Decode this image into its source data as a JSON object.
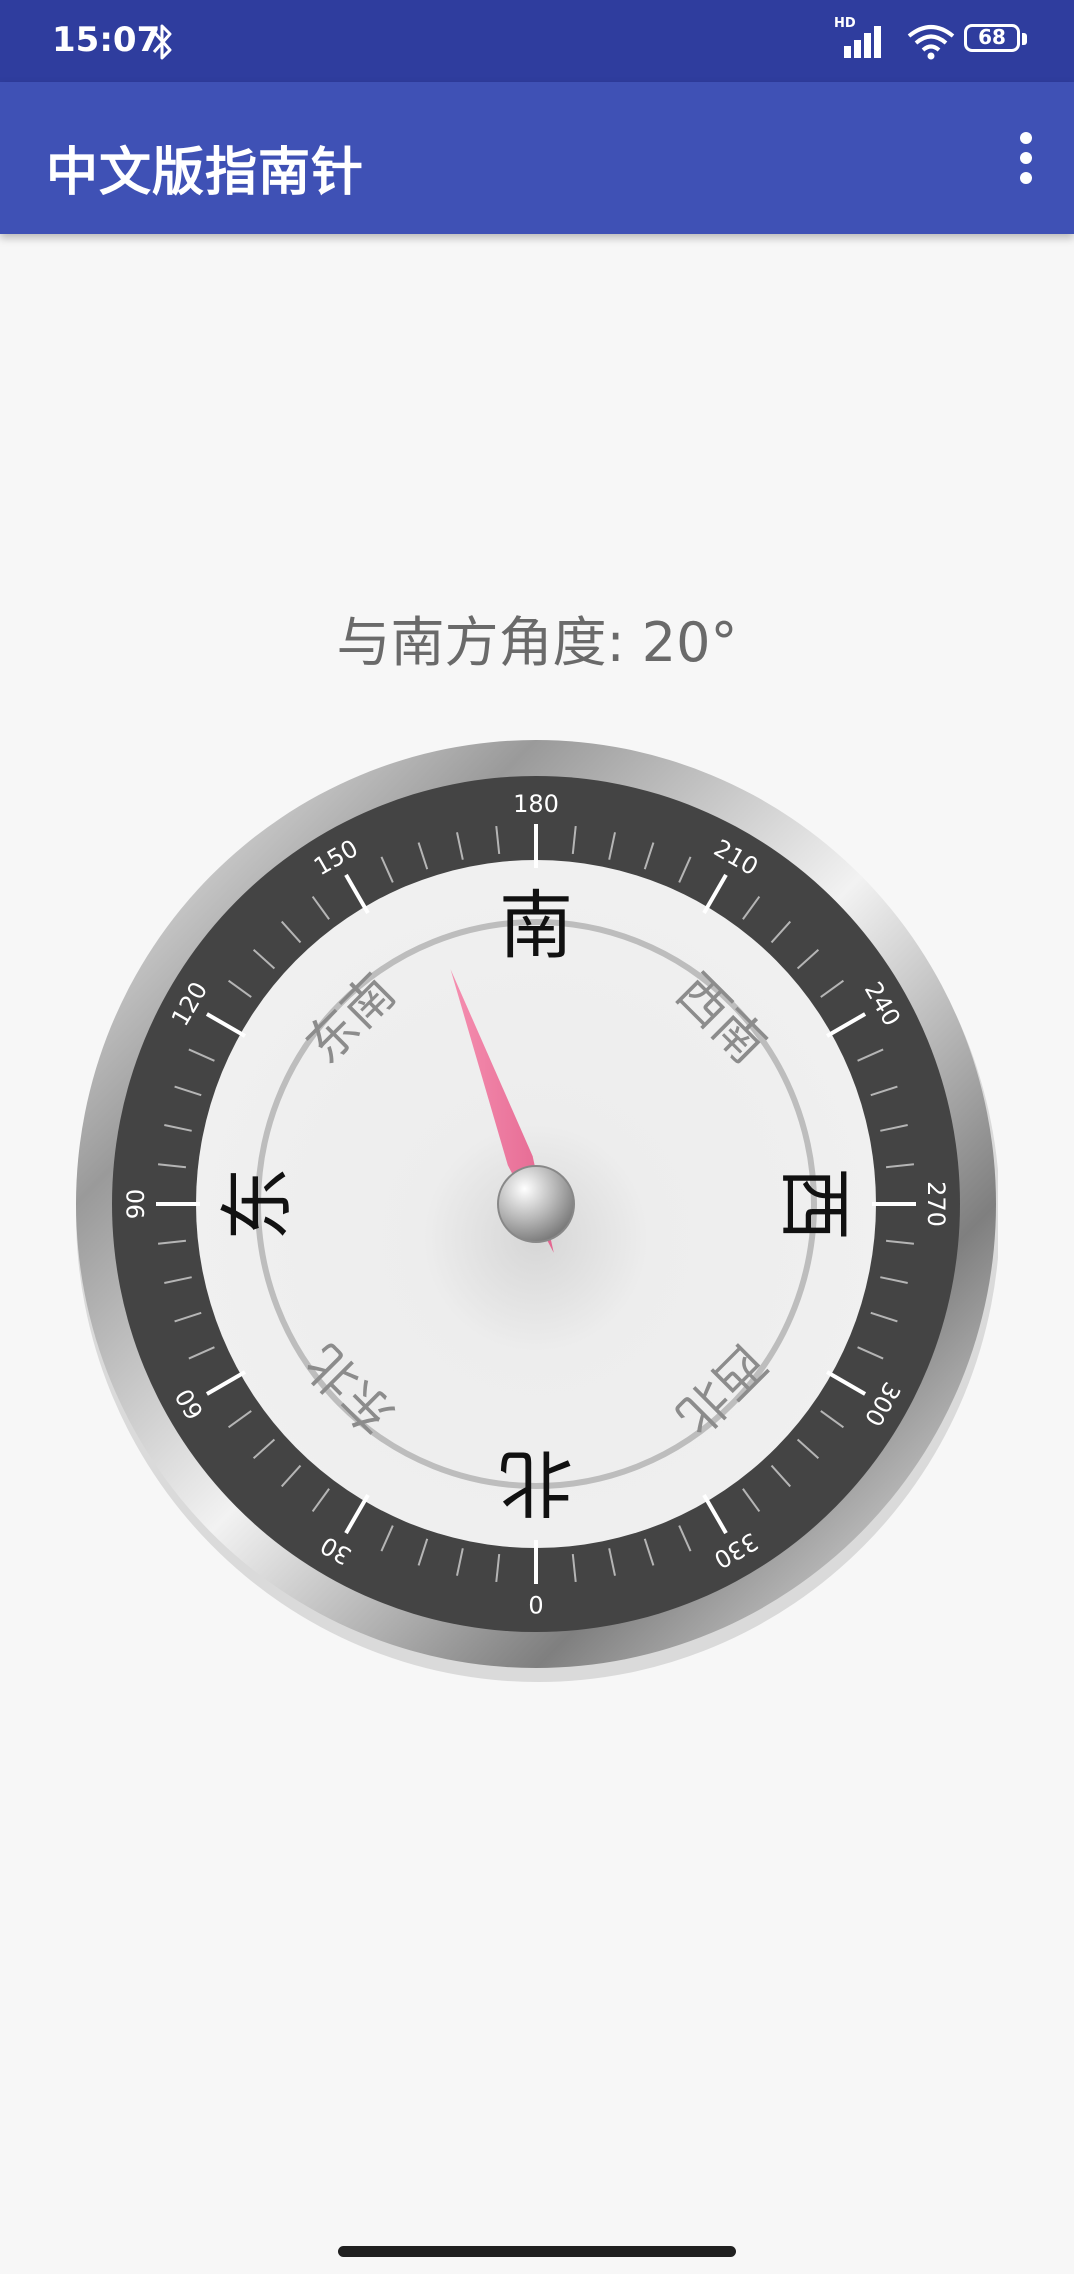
{
  "status_bar": {
    "time": "15:07",
    "network_badge": "HD",
    "battery_level": "68",
    "icons": [
      "bluetooth-icon",
      "signal-icon",
      "wifi-icon",
      "battery-icon"
    ]
  },
  "app_bar": {
    "title": "中文版指南针",
    "menu_icon": "more-vert-icon"
  },
  "reading": {
    "text": "与南方角度: 20°",
    "angle_value": 20
  },
  "compass": {
    "degree_labels": [
      "0",
      "30",
      "60",
      "90",
      "120",
      "150",
      "180",
      "210",
      "240",
      "270",
      "300",
      "330"
    ],
    "cardinal": {
      "north": "北",
      "east": "东",
      "south": "南",
      "west": "西"
    },
    "intercardinal": {
      "northeast": "东北",
      "southeast": "东南",
      "southwest": "西南",
      "northwest": "西北"
    },
    "colors": {
      "bezel_dark": "#444444",
      "dial_face": "#ececec",
      "needle": "#f07aa0",
      "tick": "#d8d8d8"
    }
  }
}
